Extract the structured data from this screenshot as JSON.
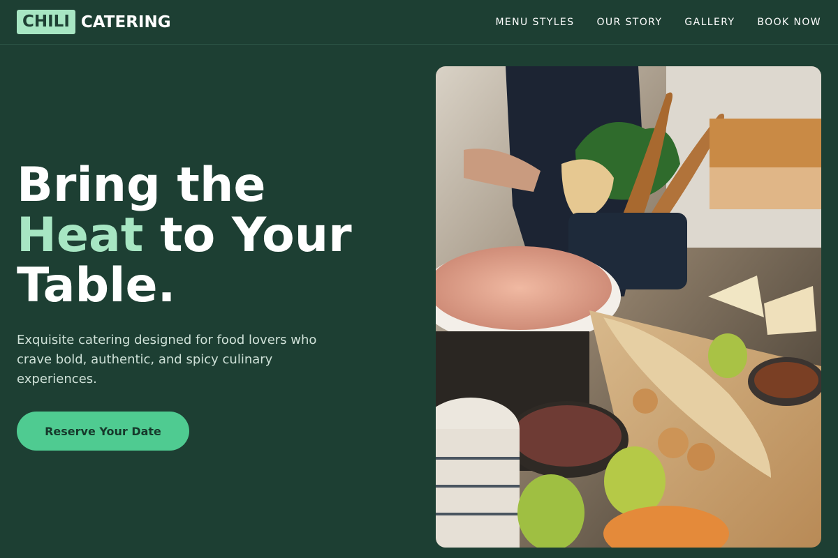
{
  "brand": {
    "badge": "CHILI",
    "name": "CATERING"
  },
  "nav": {
    "items": [
      {
        "label": "MENU STYLES"
      },
      {
        "label": "OUR STORY"
      },
      {
        "label": "GALLERY"
      },
      {
        "label": "BOOK NOW"
      }
    ]
  },
  "hero": {
    "title_line1": "Bring the",
    "title_accent": "Heat",
    "title_line2_rest": " to Your",
    "title_line3": "Table.",
    "subtitle": "Exquisite catering designed for food lovers who crave bold, authentic, and spicy culinary experiences.",
    "cta_label": "Reserve Your Date"
  },
  "colors": {
    "background": "#1d3f33",
    "accent": "#a7e6c3",
    "button": "#4fcb91",
    "button_text": "#16382b"
  },
  "image": {
    "subject": "catering-buffet-photo"
  }
}
